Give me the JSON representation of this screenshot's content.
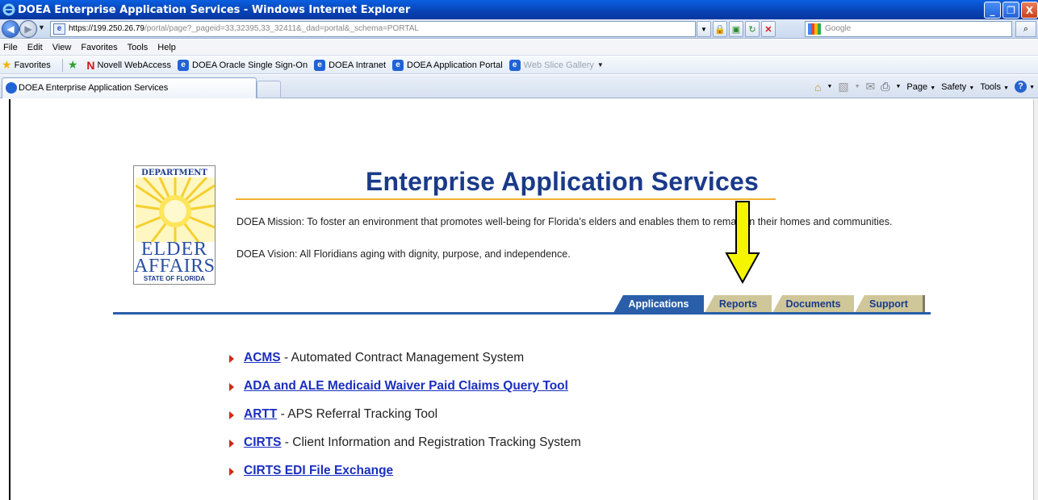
{
  "window": {
    "title": "DOEA Enterprise Application Services - Windows Internet Explorer",
    "buttons": [
      "_",
      "❐",
      "X"
    ]
  },
  "address_bar": {
    "url_host": "https://199.250.26.79",
    "url_path": "/portal/page?_pageid=33,32395,33_32411&_dad=portal&_schema=PORTAL",
    "search_placeholder": "Google"
  },
  "menu": [
    "File",
    "Edit",
    "View",
    "Favorites",
    "Tools",
    "Help"
  ],
  "favorites_bar": {
    "label": "Favorites",
    "items": [
      "Novell WebAccess",
      "DOEA Oracle Single Sign-On",
      "DOEA Intranet",
      "DOEA Application Portal",
      "Web Slice Gallery"
    ]
  },
  "tab": {
    "label": "DOEA Enterprise Application Services"
  },
  "command_bar": {
    "page": "Page",
    "safety": "Safety",
    "tools": "Tools"
  },
  "logo": {
    "top": "DEPARTMENT OF",
    "line1": "ELDER",
    "line2": "AFFAIRS",
    "bottom": "STATE OF FLORIDA"
  },
  "header": {
    "title": "Enterprise Application Services",
    "mission": "DOEA Mission: To foster an environment that promotes well-being for Florida’s elders and enables them to remain in their homes and communities.",
    "vision": "DOEA Vision: All Floridians aging with dignity, purpose, and independence."
  },
  "nav_tabs": [
    "Applications",
    "Reports",
    "Documents",
    "Support"
  ],
  "applications": [
    {
      "link": "ACMS",
      "desc": " - Automated Contract Management System"
    },
    {
      "link": "ADA and ALE Medicaid Waiver Paid Claims Query Tool",
      "desc": ""
    },
    {
      "link": "ARTT",
      "desc": " - APS Referral Tracking Tool"
    },
    {
      "link": "CIRTS",
      "desc": " - Client Information and Registration Tracking System"
    },
    {
      "link": "CIRTS EDI File Exchange",
      "desc": ""
    }
  ],
  "colors": {
    "heading": "#1a3a8a",
    "active_tab": "#2a5ea8",
    "inactive_tab": "#cfc79a",
    "link": "#1a2fc0",
    "arrow": "#f5f500"
  }
}
